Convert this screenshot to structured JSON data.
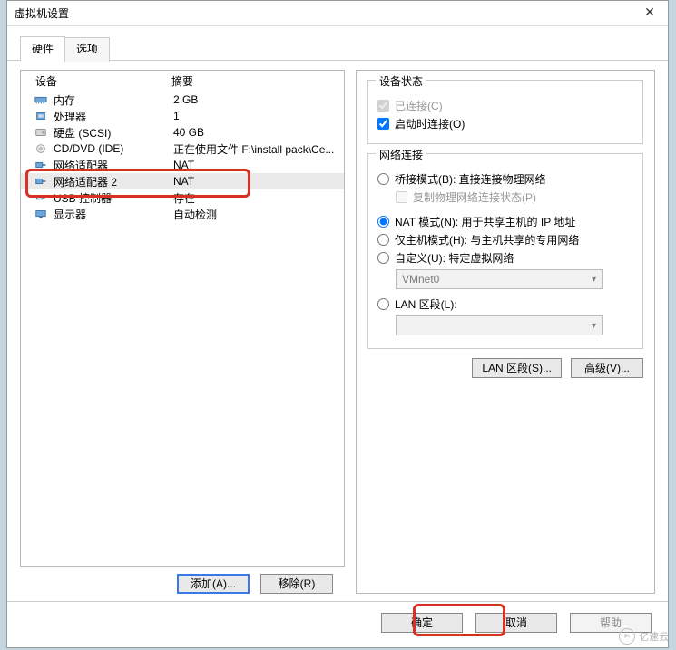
{
  "window": {
    "title": "虚拟机设置"
  },
  "tabs": {
    "hardware": "硬件",
    "options": "选项"
  },
  "columns": {
    "device": "设备",
    "summary": "摘要"
  },
  "devices": [
    {
      "name": "内存",
      "summary": "2 GB",
      "icon": "memory"
    },
    {
      "name": "处理器",
      "summary": "1",
      "icon": "cpu"
    },
    {
      "name": "硬盘 (SCSI)",
      "summary": "40 GB",
      "icon": "disk"
    },
    {
      "name": "CD/DVD (IDE)",
      "summary": "正在使用文件 F:\\install pack\\Ce...",
      "icon": "cd"
    },
    {
      "name": "网络适配器",
      "summary": "NAT",
      "icon": "net"
    },
    {
      "name": "网络适配器 2",
      "summary": "NAT",
      "icon": "net"
    },
    {
      "name": "USB 控制器",
      "summary": "存在",
      "icon": "usb"
    },
    {
      "name": "显示器",
      "summary": "自动检测",
      "icon": "display"
    }
  ],
  "left_buttons": {
    "add": "添加(A)...",
    "remove": "移除(R)"
  },
  "right": {
    "status_legend": "设备状态",
    "connected": "已连接(C)",
    "connect_on_power": "启动时连接(O)",
    "netconn_legend": "网络连接",
    "bridged": "桥接模式(B): 直接连接物理网络",
    "replicate": "复制物理网络连接状态(P)",
    "nat": "NAT 模式(N): 用于共享主机的 IP 地址",
    "hostonly": "仅主机模式(H): 与主机共享的专用网络",
    "custom": "自定义(U): 特定虚拟网络",
    "custom_value": "VMnet0",
    "lanseg": "LAN 区段(L):",
    "lanseg_btn": "LAN 区段(S)...",
    "advanced_btn": "高级(V)..."
  },
  "bottom": {
    "ok": "确定",
    "cancel": "取消",
    "help": "帮助"
  },
  "brand": "亿速云"
}
